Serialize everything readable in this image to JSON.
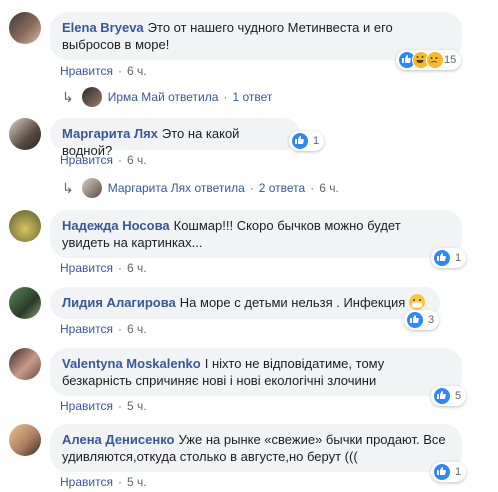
{
  "comments": [
    {
      "author": "Elena Bryeva",
      "text": "Это от нашего чудного Метинвеста и его выбросов в море!",
      "like": "Нравится",
      "time": "6 ч.",
      "reactions_count": "15",
      "replies": {
        "replier": "Ирма Май ответила",
        "count": "1 ответ",
        "time": ""
      }
    },
    {
      "author": "Маргарита Лях",
      "text": "Это на какой водной?",
      "like": "Нравится",
      "time": "6 ч.",
      "reactions_count": "1",
      "replies": {
        "replier": "Маргарита Лях ответила",
        "count": "2 ответа",
        "time": "6 ч."
      }
    },
    {
      "author": "Надежда Носова",
      "text": "Кошмар!!! Скоро бычков можно будет увидеть на картинках...",
      "like": "Нравится",
      "time": "6 ч.",
      "reactions_count": "1"
    },
    {
      "author": "Лидия Алагирова",
      "text": "На море с детьми нельзя . Инфекция",
      "like": "Нравится",
      "time": "6 ч.",
      "reactions_count": "3"
    },
    {
      "author": "Valentyna Moskalenko",
      "text": "І ніхто не відповідатиме, тому безкарність спричиняє нові і нові екологічні злочини",
      "like": "Нравится",
      "time": "5 ч.",
      "reactions_count": "5"
    },
    {
      "author": "Алена Денисенко",
      "text": "Уже на рынке «свежие» бычки продают. Все удивляются,откуда столько в августе,но берут (((",
      "like": "Нравится",
      "time": "5 ч.",
      "reactions_count": "1"
    }
  ],
  "separator": "·",
  "colors": {
    "link": "#385898",
    "bubble": "#f2f3f5",
    "like": "#2d88ff",
    "meta": "#606770"
  }
}
